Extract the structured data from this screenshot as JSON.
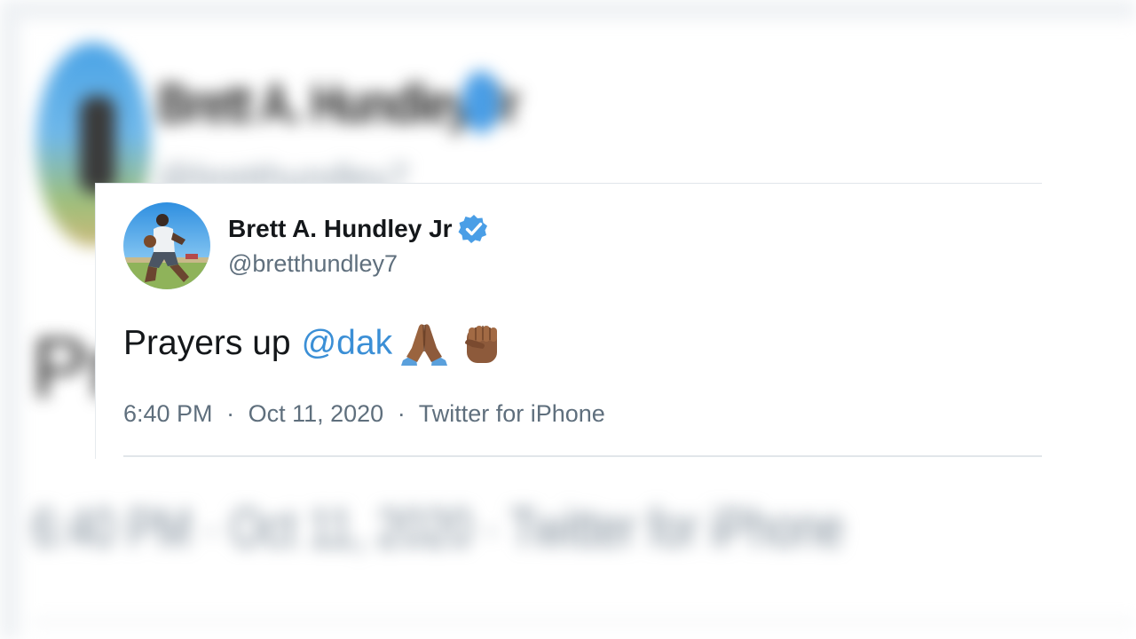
{
  "background_tweet": {
    "display_name": "Brett A. Hundley Jr",
    "handle": "@bretthundley7",
    "text": "Prayers up",
    "meta": "6:40 PM · Oct 11, 2020 · Twitter for iPhone"
  },
  "tweet": {
    "display_name": "Brett A. Hundley Jr",
    "handle": "@bretthundley7",
    "verified": true,
    "text": "Prayers up",
    "mention": "@dak",
    "emojis": [
      "folded-hands-icon",
      "raised-fist-icon"
    ],
    "time": "6:40 PM",
    "date": "Oct 11, 2020",
    "source": "Twitter for iPhone",
    "separator": "·"
  },
  "colors": {
    "text": "#14171a",
    "secondary": "#5f6f7d",
    "link": "#3b8fd6",
    "verified_badge": "#4a9ee6",
    "skin_tone": "#8d5a3b"
  }
}
